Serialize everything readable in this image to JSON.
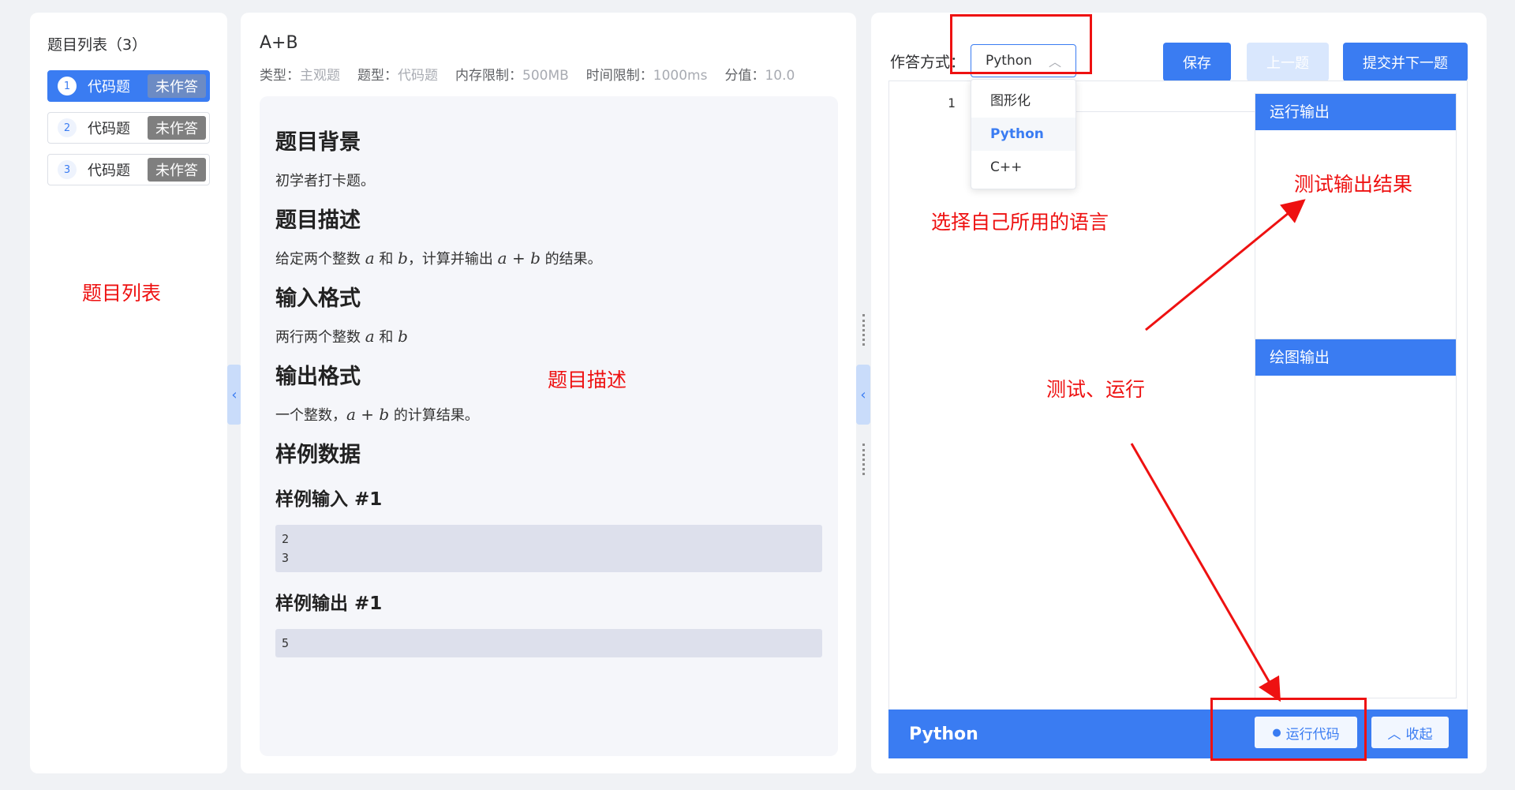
{
  "question_list": {
    "title": "题目列表（3）",
    "items": [
      {
        "num": "1",
        "label": "代码题",
        "status": "未作答",
        "active": true
      },
      {
        "num": "2",
        "label": "代码题",
        "status": "未作答",
        "active": false
      },
      {
        "num": "3",
        "label": "代码题",
        "status": "未作答",
        "active": false
      }
    ]
  },
  "problem": {
    "title": "A+B",
    "meta": [
      {
        "key": "类型：",
        "value": "主观题"
      },
      {
        "key": "题型：",
        "value": "代码题"
      },
      {
        "key": "内存限制：",
        "value": "500MB"
      },
      {
        "key": "时间限制：",
        "value": "1000ms"
      },
      {
        "key": "分值：",
        "value": "10.0"
      }
    ],
    "background_heading": "题目背景",
    "background_text": "初学者打卡题。",
    "description_heading": "题目描述",
    "description_parts": [
      "给定两个整数 ",
      "a",
      " 和 ",
      "b",
      "，计算并输出 ",
      "a + b",
      " 的结果。"
    ],
    "input_heading": "输入格式",
    "input_parts": [
      "两行两个整数 ",
      "a",
      " 和 ",
      "b"
    ],
    "output_heading": "输出格式",
    "output_parts": [
      "一个整数，",
      "a + b",
      " 的计算结果。"
    ],
    "sample_heading": "样例数据",
    "sample_input_heading": "样例输入 #1",
    "sample_input": "2\n3",
    "sample_output_heading": "样例输出 #1",
    "sample_output": "5"
  },
  "answer": {
    "mode_label": "作答方式：",
    "selected_language": "Python",
    "save_label": "保存",
    "prev_label": "上一题",
    "submit_next_label": "提交并下一题",
    "line_number": "1",
    "language_options": [
      "图形化",
      "Python",
      "C++"
    ],
    "run_output_title": "运行输出",
    "draw_output_title": "绘图输出",
    "bottom_language": "Python",
    "run_code_label": "运行代码",
    "collapse_label": "收起"
  },
  "annotations": {
    "question_list": "题目列表",
    "problem_desc": "题目描述",
    "choose_language": "选择自己所用的语言",
    "test_output": "测试输出结果",
    "test_run": "测试、运行"
  },
  "colors": {
    "primary": "#3a7cf2",
    "annotation": "#ee1111"
  }
}
